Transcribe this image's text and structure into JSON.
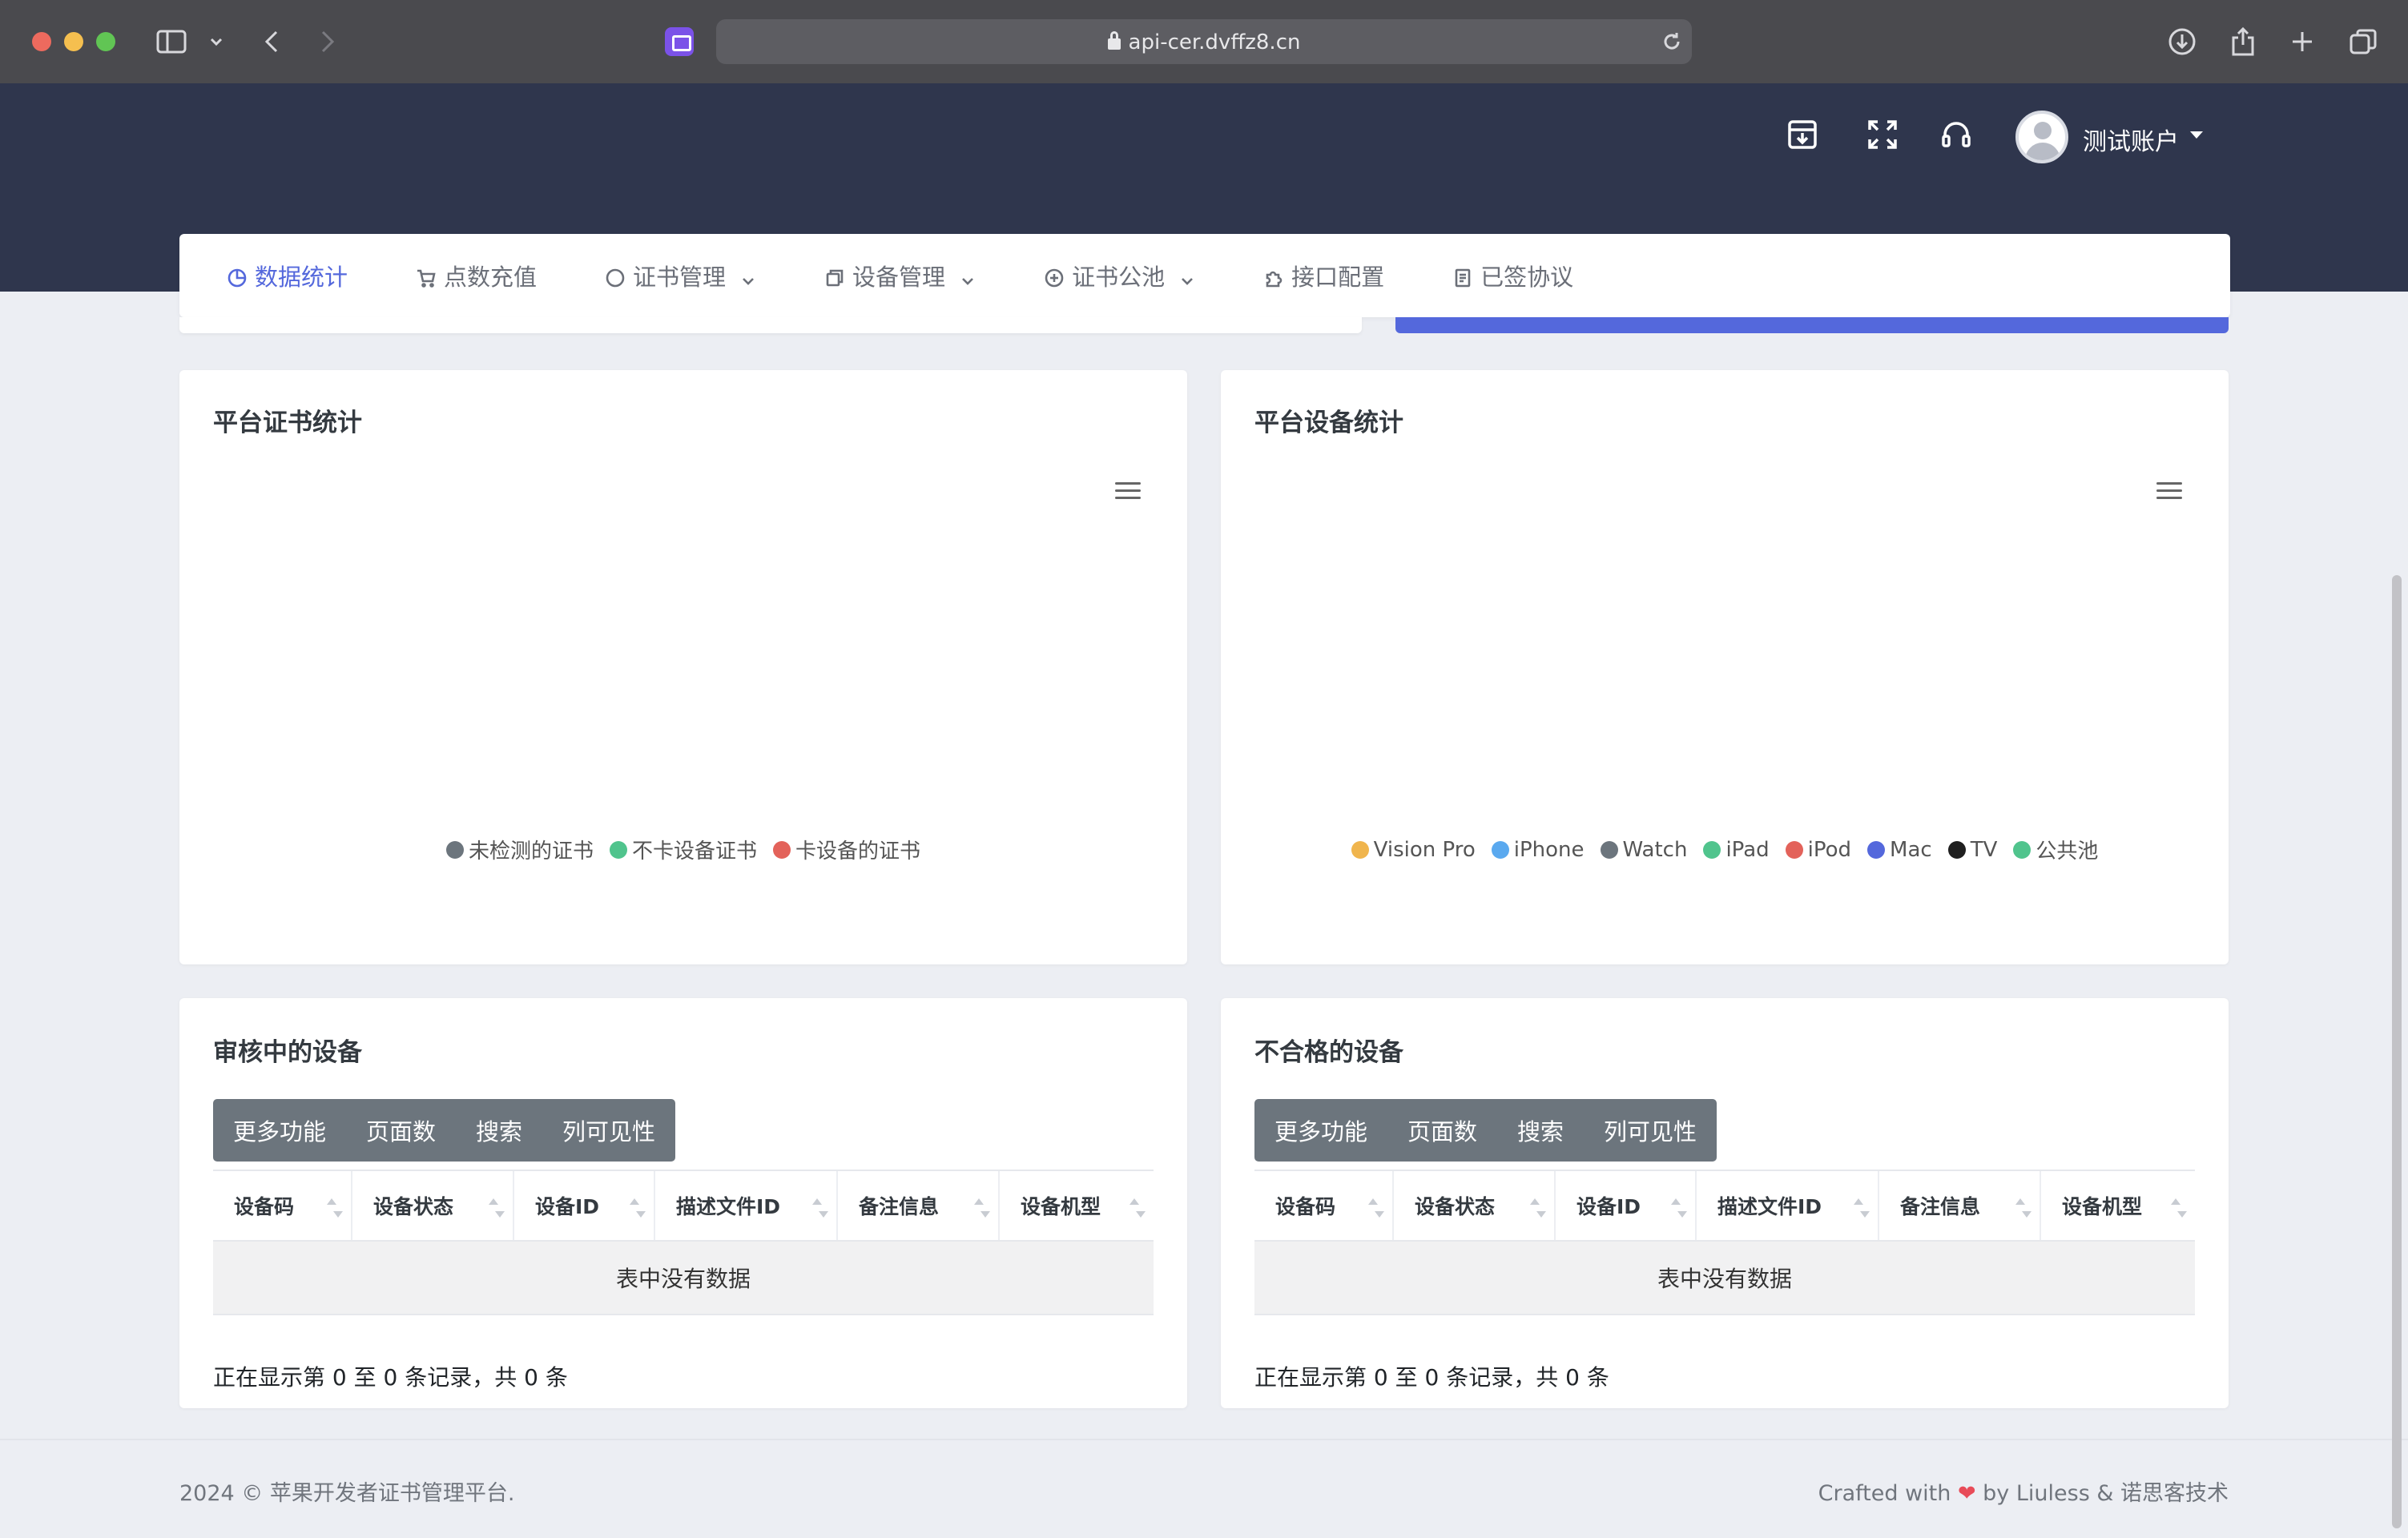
{
  "browser": {
    "url": "api-cer.dvffz8.cn"
  },
  "header": {
    "user_name": "测试账户"
  },
  "nav": {
    "items": [
      {
        "label": "数据统计",
        "icon": "pie-chart-icon",
        "active": true
      },
      {
        "label": "点数充值",
        "icon": "cart-icon"
      },
      {
        "label": "证书管理",
        "icon": "circle-icon",
        "has_dropdown": true
      },
      {
        "label": "设备管理",
        "icon": "copy-icon",
        "has_dropdown": true
      },
      {
        "label": "证书公池",
        "icon": "plus-circle-icon",
        "has_dropdown": true
      },
      {
        "label": "接口配置",
        "icon": "puzzle-icon"
      },
      {
        "label": "已签协议",
        "icon": "document-icon"
      }
    ]
  },
  "cert_stats": {
    "title": "平台证书统计",
    "legend": [
      {
        "label": "未检测的证书",
        "color": "#6c757d"
      },
      {
        "label": "不卡设备证书",
        "color": "#50c48d"
      },
      {
        "label": "卡设备的证书",
        "color": "#e3625a"
      }
    ]
  },
  "device_stats": {
    "title": "平台设备统计",
    "legend": [
      {
        "label": "Vision Pro",
        "color": "#f0b54d"
      },
      {
        "label": "iPhone",
        "color": "#5aa9ef"
      },
      {
        "label": "Watch",
        "color": "#6c757d"
      },
      {
        "label": "iPad",
        "color": "#50c48d"
      },
      {
        "label": "iPod",
        "color": "#e3625a"
      },
      {
        "label": "Mac",
        "color": "#5468dc"
      },
      {
        "label": "TV",
        "color": "#1f1f1f"
      },
      {
        "label": "公共池",
        "color": "#50c48d"
      }
    ]
  },
  "pending_devices": {
    "title": "审核中的设备",
    "buttons": [
      "更多功能",
      "页面数",
      "搜索",
      "列可见性"
    ],
    "columns": [
      "设备码",
      "设备状态",
      "设备ID",
      "描述文件ID",
      "备注信息",
      "设备机型"
    ],
    "empty_text": "表中没有数据",
    "info": "正在显示第 0 至 0 条记录，共 0 条"
  },
  "invalid_devices": {
    "title": "不合格的设备",
    "buttons": [
      "更多功能",
      "页面数",
      "搜索",
      "列可见性"
    ],
    "columns": [
      "设备码",
      "设备状态",
      "设备ID",
      "描述文件ID",
      "备注信息",
      "设备机型"
    ],
    "empty_text": "表中没有数据",
    "info": "正在显示第 0 至 0 条记录，共 0 条"
  },
  "footer": {
    "left": "2024 © 苹果开发者证书管理平台.",
    "right_prefix": "Crafted with",
    "heart": "❤",
    "right_suffix": "by Liuless & 诺思客技术"
  }
}
